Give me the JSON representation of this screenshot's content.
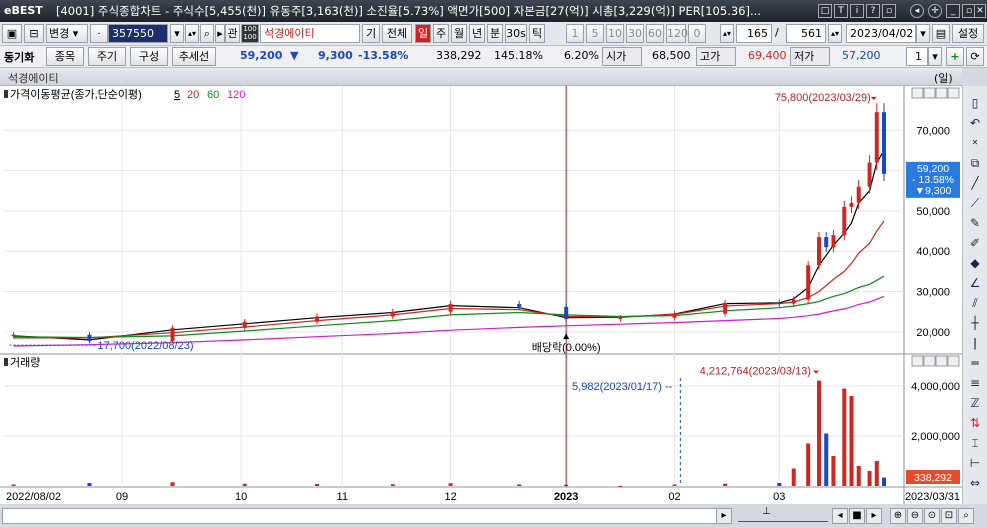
{
  "window": {
    "logo": "eBEST",
    "title": "[4001] 주식종합차트 - 주식수[5,455(천)] 유동주[3,163(천)] 소진율[5.73%] 액면가[500] 자본금[27(억)] 시총[3,229(억)] PER[105.36]..."
  },
  "toolbar1": {
    "mode": "변경",
    "code": "357550",
    "gwan": "관",
    "name": "석경에이티",
    "gi": "기",
    "all": "전체",
    "periods": [
      "일",
      "주",
      "월",
      "년",
      "분",
      "30s",
      "틱"
    ],
    "active_period": "일",
    "intervals": [
      "1",
      "5",
      "10",
      "30",
      "60",
      "120",
      "0"
    ],
    "count": "165",
    "total": "561",
    "date": "2023/04/02",
    "settings": "설정"
  },
  "toolbar2": {
    "sync": "동기화",
    "btn_item": "종목",
    "btn_period": "주기",
    "btn_compose": "구성",
    "btn_trend": "추세선",
    "price": "59,200",
    "arrow": "▼",
    "change": "9,300",
    "change_pct": "-13.58%",
    "volume": "338,292",
    "vol_ratio": "145.18%",
    "turnover": "6.20%",
    "open_label": "시가",
    "open": "68,500",
    "high_label": "고가",
    "high": "69,400",
    "low_label": "저가",
    "low": "57,200",
    "layout_count": "1"
  },
  "chart_header": {
    "name": "석경에이티",
    "unit": "(일)"
  },
  "price_panel": {
    "ma_label": "가격이동평균(종가,단순이평)",
    "ma_periods": [
      "5",
      "20",
      "60",
      "120"
    ],
    "ma_colors": [
      "#000000",
      "#d0261f",
      "#118a1e",
      "#d21ad2"
    ],
    "high_note": "75,800(2023/03/29)",
    "low_note": "17,700(2022/08/23)",
    "dividend_note": "배당락(0.00%)",
    "price_tag": [
      "59,200",
      "- 13.58%",
      "▼9,300"
    ],
    "y_ticks": [
      "70,000",
      "60,000",
      "50,000",
      "40,000",
      "30,000",
      "20,000"
    ]
  },
  "volume_panel": {
    "label": "거래량",
    "high_note": "4,212,764(2023/03/13)",
    "marker_note": "5,982(2023/01/17)",
    "last_tag": "338,292",
    "y_ticks": [
      "4,000,000",
      "2,000,000"
    ]
  },
  "x_axis": {
    "labels": [
      "2022/08/02",
      "09",
      "10",
      "11",
      "12",
      "2023",
      "02",
      "03",
      "2023/03/31"
    ]
  },
  "chart_data": [
    {
      "type": "line",
      "title": "석경에이티",
      "x": [
        "2022/08/02",
        "2022/08/23",
        "2022/09/15",
        "2022/10/05",
        "2022/10/25",
        "2022/11/15",
        "2022/12/01",
        "2022/12/20",
        "2023/01/02",
        "2023/01/17",
        "2023/02/01",
        "2023/02/15",
        "2023/03/02",
        "2023/03/06",
        "2023/03/10",
        "2023/03/13",
        "2023/03/15",
        "2023/03/17",
        "2023/03/20",
        "2023/03/22",
        "2023/03/24",
        "2023/03/27",
        "2023/03/29",
        "2023/03/31"
      ],
      "series": [
        {
          "name": "종가",
          "values": [
            19300,
            17700,
            21000,
            22500,
            23800,
            25000,
            26900,
            26200,
            23200,
            23500,
            24500,
            27200,
            27000,
            28000,
            36500,
            43500,
            41000,
            44000,
            51000,
            52000,
            56000,
            62000,
            74500,
            59200
          ]
        },
        {
          "name": "5",
          "values": [
            19000,
            18000,
            20500,
            22000,
            23500,
            24800,
            26500,
            26000,
            23500,
            23600,
            24400,
            27000,
            27200,
            28200,
            31000,
            36500,
            39000,
            41500,
            44500,
            47000,
            52000,
            55000,
            62000,
            65000
          ]
        },
        {
          "name": "20",
          "values": [
            18500,
            18500,
            19800,
            21200,
            22800,
            24200,
            25800,
            25500,
            23800,
            23700,
            24300,
            26400,
            27000,
            27400,
            28500,
            30000,
            31500,
            33000,
            35000,
            37000,
            39500,
            42000,
            45000,
            47500
          ]
        },
        {
          "name": "60",
          "values": [
            18800,
            18600,
            19000,
            20200,
            21500,
            22800,
            24200,
            24800,
            24200,
            23800,
            24000,
            25200,
            26000,
            26400,
            27000,
            27500,
            28200,
            28800,
            29500,
            30200,
            31000,
            31800,
            32800,
            33800
          ]
        },
        {
          "name": "120",
          "values": [
            16500,
            16800,
            17300,
            18000,
            18800,
            19600,
            20400,
            21100,
            21500,
            21900,
            22300,
            22800,
            23300,
            23600,
            24000,
            24400,
            24800,
            25200,
            25700,
            26200,
            26800,
            27400,
            28100,
            28800
          ]
        }
      ],
      "ylim": [
        15000,
        80000
      ]
    },
    {
      "type": "bar",
      "title": "거래량",
      "categories": [
        "2022/08/02",
        "2022/08/23",
        "2022/09/15",
        "2022/10/05",
        "2022/10/25",
        "2022/11/15",
        "2022/12/01",
        "2022/12/20",
        "2023/01/02",
        "2023/01/17",
        "2023/02/01",
        "2023/02/15",
        "2023/03/02",
        "2023/03/06",
        "2023/03/10",
        "2023/03/13",
        "2023/03/15",
        "2023/03/17",
        "2023/03/20",
        "2023/03/22",
        "2023/03/24",
        "2023/03/27",
        "2023/03/29",
        "2023/03/31"
      ],
      "values": [
        60000,
        120000,
        150000,
        90000,
        80000,
        70000,
        110000,
        60000,
        50000,
        5982,
        60000,
        90000,
        120000,
        700000,
        1700000,
        4212764,
        2100000,
        1200000,
        3900000,
        3600000,
        800000,
        600000,
        1000000,
        338292
      ],
      "ylim": [
        0,
        4800000
      ]
    }
  ]
}
